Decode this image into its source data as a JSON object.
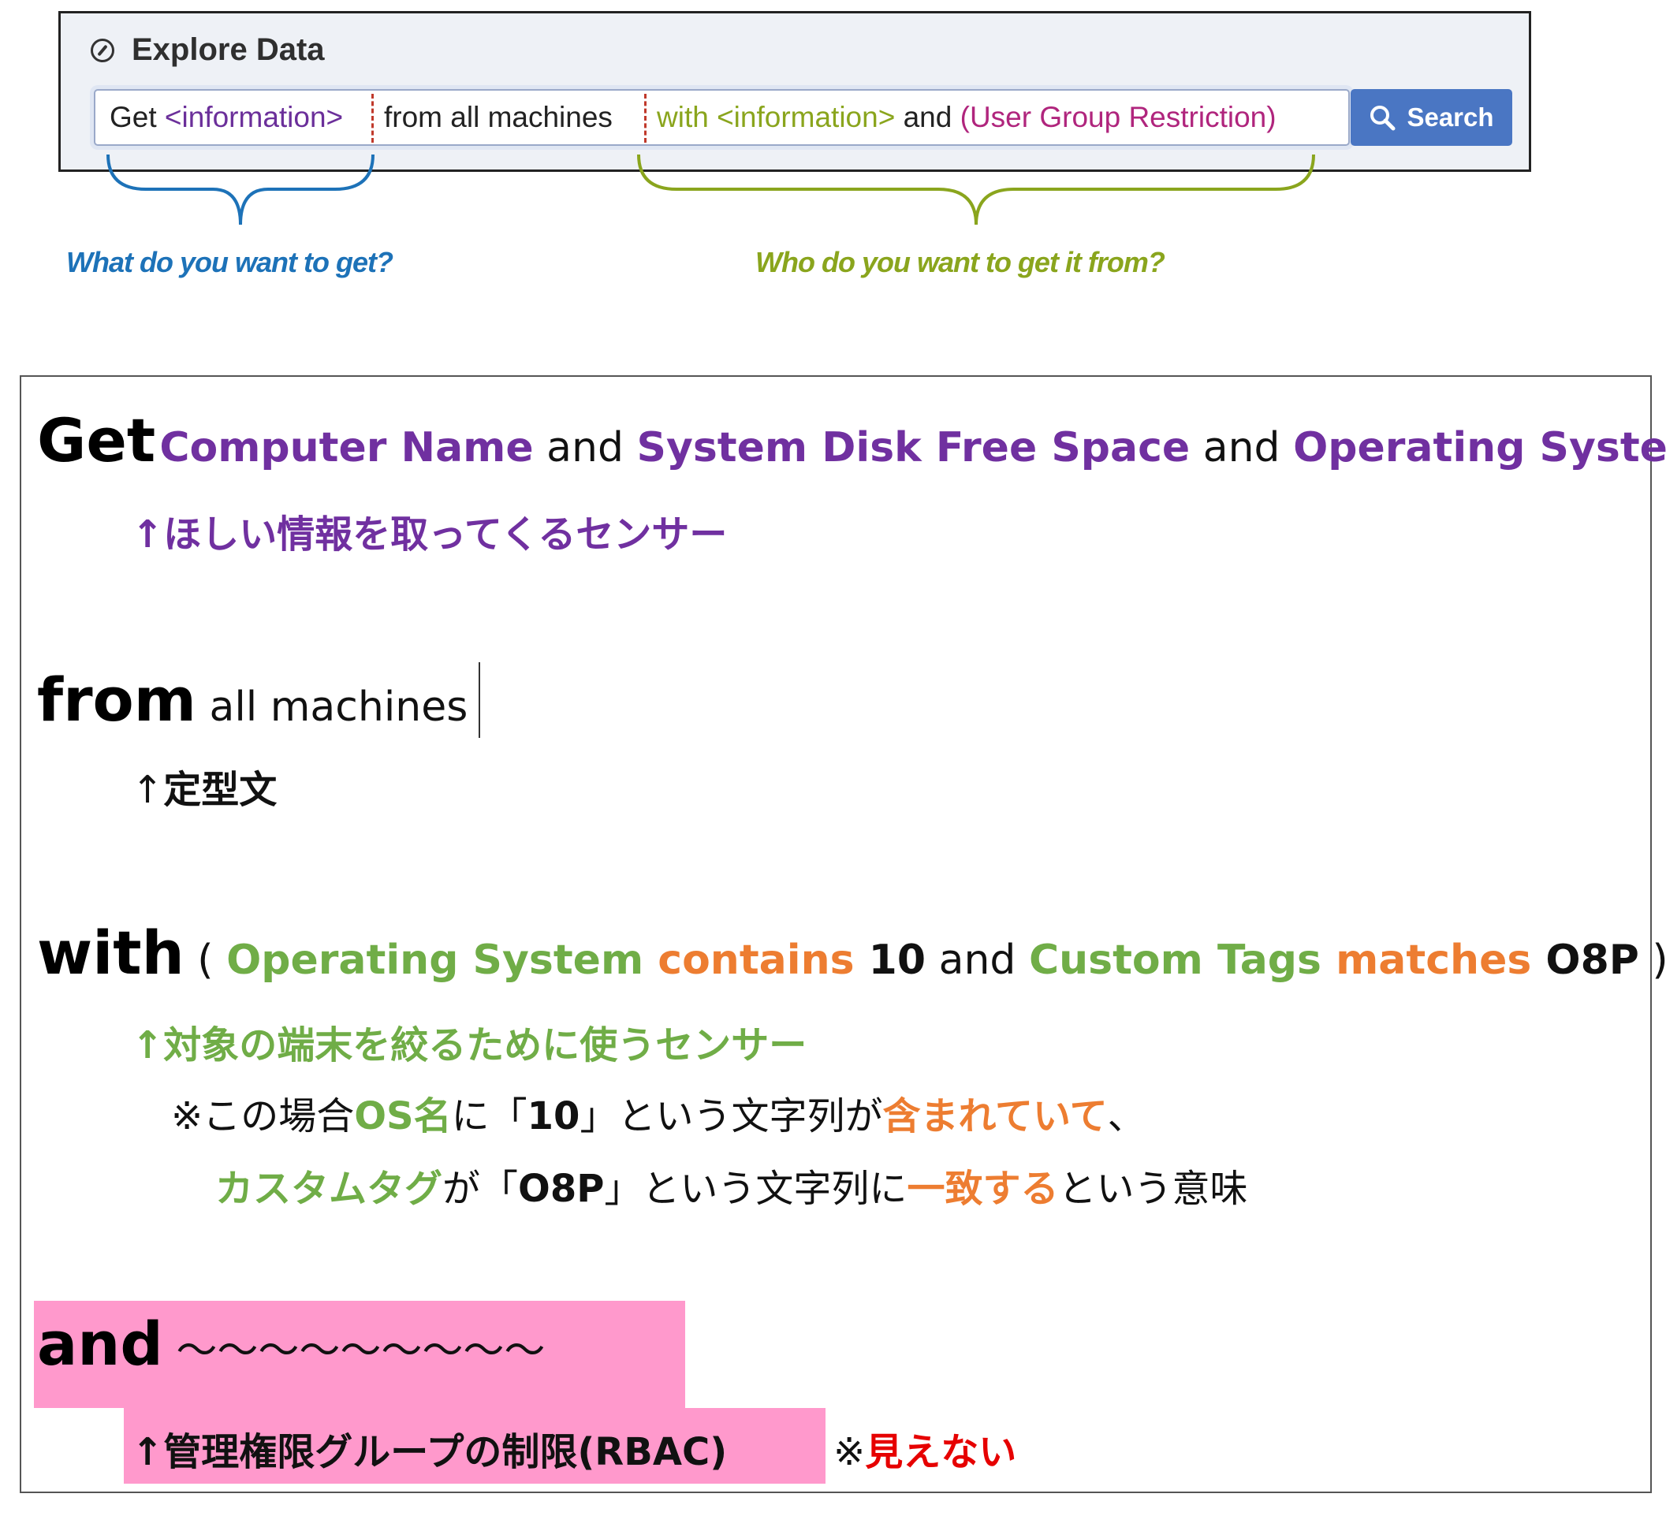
{
  "explore_ui": {
    "title": "Explore Data",
    "query": {
      "seg1_prefix": "Get ",
      "seg1_info": "<information>",
      "seg2": "from all machines",
      "seg3_with": "with <information>",
      "seg3_and": " and ",
      "seg3_restriction": "(User Group Restriction)"
    },
    "search_label": "Search",
    "caption_left": "What do you want to get?",
    "caption_right": "Who do you want to get it from?"
  },
  "explanation": {
    "get_line": {
      "keyword": "Get",
      "s1": "Computer Name",
      "and1": " and ",
      "s2": "System Disk Free Space",
      "and2": " and ",
      "s3": "Operating System"
    },
    "get_note": "↑ほしい情報を取ってくるセンサー",
    "from_line": {
      "keyword": "from",
      "rest": " all machines"
    },
    "from_note_arrow": "↑",
    "from_note_text": "定型文",
    "with_line": {
      "keyword": "with",
      "open": " ( ",
      "s1": "Operating System",
      "op1": " contains ",
      "v1": "10",
      "and": " and ",
      "s2": "Custom Tags",
      "op2": " matches ",
      "v2": "O8P",
      "close": " )"
    },
    "with_note": "↑対象の端末を絞るために使うセンサー",
    "with_detail1": {
      "prefix": "※この場合",
      "os": "OS名",
      "mid1": "に「",
      "v": "10",
      "mid2": "」という文字列が",
      "contains": "含まれていて",
      "end": "、"
    },
    "with_detail2": {
      "tag": "カスタムタグ",
      "mid1": "が「",
      "v": "O8P",
      "mid2": "」という文字列に",
      "match": "一致する",
      "end": "という意味"
    },
    "and_line": {
      "keyword": "and",
      "rest": " ～～～～～～～～～"
    },
    "and_note": "↑管理権限グループの制限(RBAC)",
    "and_note_mark": "※",
    "and_note_red": "見えない"
  },
  "colors": {
    "purple": "#7030a0",
    "green": "#70ad47",
    "orange": "#ed7d31",
    "red": "#e60000",
    "highlight_pink": "#ff99cc",
    "search_button": "#4a76c3",
    "brace_blue": "#1d72b8",
    "brace_green": "#8aa51d"
  }
}
